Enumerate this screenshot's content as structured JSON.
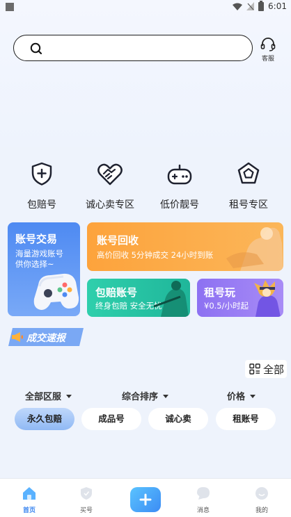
{
  "status_bar": {
    "time": "6:01"
  },
  "search": {
    "placeholder": ""
  },
  "header": {
    "service_label": "客服"
  },
  "quick_menu": [
    {
      "label": "包赔号",
      "icon": "shield-plus-icon"
    },
    {
      "label": "诚心卖专区",
      "icon": "handshake-icon"
    },
    {
      "label": "低价靓号",
      "icon": "gamepad-icon"
    },
    {
      "label": "租号专区",
      "icon": "pentagon-badge-icon"
    }
  ],
  "cards": {
    "trade": {
      "title": "账号交易",
      "sub1": "海量游戏账号",
      "sub2": "供你选择~"
    },
    "recycle": {
      "title": "账号回收",
      "sub": "高价回收 5分钟成交 24小时到账"
    },
    "guarantee": {
      "title": "包赔账号",
      "sub": "终身包赔 安全无忧"
    },
    "rent": {
      "title": "租号玩",
      "sub": "¥0.5/小时起"
    }
  },
  "ticker": {
    "label": "成交速报"
  },
  "all_button": {
    "label": "全部"
  },
  "filters": [
    {
      "label": "全部区服"
    },
    {
      "label": "综合排序"
    },
    {
      "label": "价格"
    }
  ],
  "chips": [
    {
      "label": "永久包赔",
      "active": true
    },
    {
      "label": "成品号",
      "active": false
    },
    {
      "label": "诚心卖",
      "active": false
    },
    {
      "label": "租账号",
      "active": false
    }
  ],
  "tabs": [
    {
      "label": "首页",
      "active": true
    },
    {
      "label": "买号",
      "active": false
    },
    {
      "label": "消息",
      "active": false
    },
    {
      "label": "我的",
      "active": false
    }
  ],
  "colors": {
    "accent": "#3b86f0",
    "recycle": "#fda33c",
    "guarantee": "#2fcfac",
    "rent": "#8d71f2",
    "trade": "#4e8af2"
  }
}
